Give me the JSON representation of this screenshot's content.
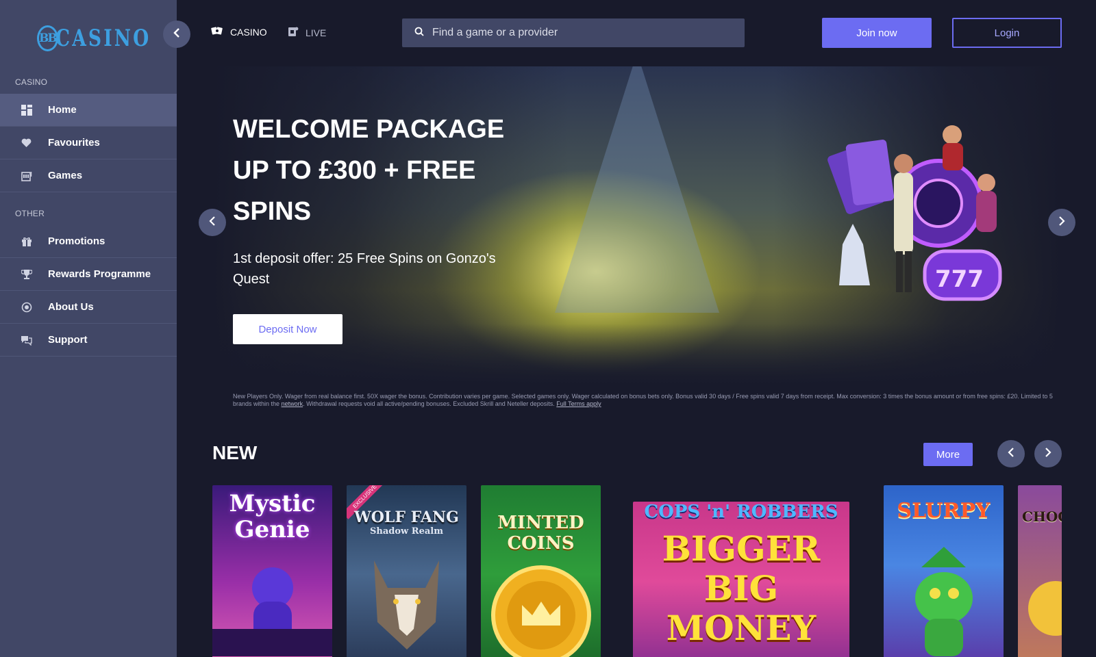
{
  "logo": {
    "mark": "BB",
    "word": "CASINO"
  },
  "sidebar": {
    "sections": [
      {
        "label": "CASINO"
      },
      {
        "label": "OTHER"
      }
    ],
    "items": [
      {
        "label": "Home",
        "icon": "grid-icon"
      },
      {
        "label": "Favourites",
        "icon": "heart-icon"
      },
      {
        "label": "Games",
        "icon": "slot-machine-icon"
      },
      {
        "label": "Promotions",
        "icon": "gift-icon"
      },
      {
        "label": "Rewards Programme",
        "icon": "trophy-icon"
      },
      {
        "label": "About Us",
        "icon": "info-icon"
      },
      {
        "label": "Support",
        "icon": "chat-icon"
      }
    ]
  },
  "header": {
    "tabs": [
      {
        "label": "CASINO",
        "icon": "cards-icon"
      },
      {
        "label": "LIVE",
        "icon": "live-icon"
      }
    ],
    "search": {
      "placeholder": "Find a game or a provider"
    },
    "join_label": "Join now",
    "login_label": "Login"
  },
  "hero": {
    "title": "WELCOME PACKAGE UP TO £300 + FREE SPINS",
    "subtitle": "1st deposit offer: 25 Free Spins on Gonzo's Quest",
    "cta_label": "Deposit Now"
  },
  "terms": {
    "text": "New Players Only. Wager from real balance first. 50X wager the bonus. Contribution varies per game. Selected games only. Wager calculated on bonus bets only. Bonus valid 30 days / Free spins valid 7 days from receipt. Max conversion: 3 times the bonus amount or from free spins: £20. Limited to 5 brands within the",
    "network_link": "network",
    "text2": ". Withdrawal requests void all active/pending bonuses. Excluded Skrill and Neteller deposits.",
    "full_terms_link": "Full Terms apply"
  },
  "new_section": {
    "title": "NEW",
    "more_label": "More",
    "games": [
      {
        "name": "Mystic Genie"
      },
      {
        "name": "WOLF FANG",
        "subtitle": "Shadow Realm",
        "badge": "EXCLUSIVE"
      },
      {
        "name": "MINTED COINS"
      },
      {
        "name": "BIGGER BIG MONEY",
        "subtitle": "COPS 'n' ROBBERS"
      },
      {
        "name": "SLURPY"
      },
      {
        "name": "CHOC"
      }
    ]
  },
  "colors": {
    "background": "#181a2b",
    "sidebar": "#414766",
    "accent": "#6c6cf2",
    "logo": "#3d9fe0"
  }
}
